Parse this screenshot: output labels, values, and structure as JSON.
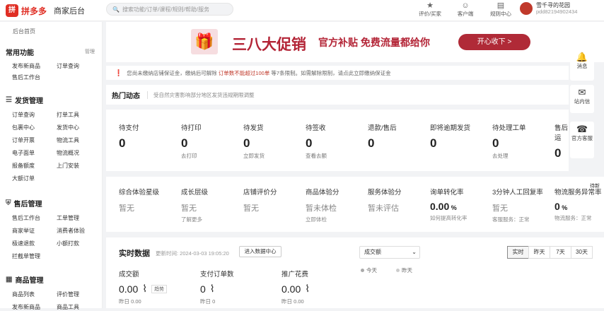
{
  "header": {
    "logo_mark": "拼",
    "logo_text": "拼多多",
    "logo_sub": "商家后台",
    "search_placeholder": "搜索功能/订单/课程/规则/帮助/服务",
    "icons": [
      {
        "name": "rate-icon",
        "glyph": "★",
        "label": "评价/买家"
      },
      {
        "name": "customer-icon",
        "glyph": "☺",
        "label": "客户端"
      },
      {
        "name": "rules-icon",
        "glyph": "▤",
        "label": "规则中心"
      }
    ],
    "shop_name": "雪千寻的花园",
    "shop_id": "pdd82194902434"
  },
  "sidebar": {
    "home": "后台首页",
    "common_title": "常用功能",
    "manage": "管理",
    "common": [
      "发布新商品",
      "订单查询",
      "售后工作台"
    ],
    "ship_title": "发货管理",
    "ship": [
      "订单查询",
      "打单工具",
      "包裹中心",
      "发货中心",
      "订单开票",
      "物流工具",
      "电子面单",
      "物流概况",
      "报备额度",
      "上门安装",
      "大额订单"
    ],
    "after_title": "售后管理",
    "after": [
      "售后工作台",
      "工单管理",
      "商家举证",
      "消费者体验",
      "极速退款",
      "小额打款",
      "拦截单管理"
    ],
    "goods_title": "商品管理",
    "goods": [
      "商品列表",
      "评价管理",
      "发布新商品",
      "商品工具"
    ]
  },
  "banner": {
    "title": "三八大促销",
    "sub": "官方补贴 免费流量都给你",
    "button": "开心收下 >"
  },
  "notice": {
    "text": "您尚未缴纳店铺保证金，缴纳后可解除 ",
    "highlight": "订单数不能超过100单",
    "rest": " 等7条限制。如需解除限制，请点此立即缴纳保证金"
  },
  "hot": {
    "title": "热门动态",
    "desc": "受自然灾害影响部分地区发货违规期限调整"
  },
  "orders": [
    {
      "label": "待支付",
      "value": "0",
      "sub": ""
    },
    {
      "label": "待打印",
      "value": "0",
      "sub": "去打印"
    },
    {
      "label": "待发货",
      "value": "0",
      "sub": "立即发货"
    },
    {
      "label": "待签收",
      "value": "0",
      "sub": "查看去额"
    },
    {
      "label": "退款/售后",
      "value": "0",
      "sub": ""
    },
    {
      "label": "即将逾期发货",
      "value": "0",
      "sub": ""
    },
    {
      "label": "待处理工单",
      "value": "0",
      "sub": "去处理"
    },
    {
      "label": "售后运",
      "value": "0",
      "sub": ""
    }
  ],
  "metrics": [
    {
      "label": "综合体验星级",
      "value": "暂无",
      "sub": ""
    },
    {
      "label": "成长层级",
      "value": "暂无",
      "sub": "了解更多"
    },
    {
      "label": "店铺评价分",
      "value": "暂无",
      "sub": ""
    },
    {
      "label": "商品体验分",
      "value": "暂未体检",
      "sub": "立即体检"
    },
    {
      "label": "服务体验分",
      "value": "暂未评估",
      "sub": ""
    },
    {
      "label": "询单转化率",
      "value": "0.00",
      "unit": "%",
      "sub": "如何提高转化率"
    },
    {
      "label": "3分钟人工回复率",
      "value": "暂无",
      "sub": "客服服务：正常"
    },
    {
      "label": "物流服务异常率",
      "value": "0",
      "unit": "%",
      "sub": "物流服务：正常"
    }
  ],
  "realtime": {
    "title": "实时数据",
    "time": "更新时间: 2024-03-03 19:05:20",
    "enter": "进入数据中心",
    "select": "成交额",
    "ranges": [
      "实时",
      "昨天",
      "7天",
      "30天"
    ],
    "today": "今天",
    "yesterday": "昨天",
    "stats": [
      {
        "label": "成交额",
        "value": "0.00",
        "tag": "趋势",
        "sub": "昨日 0.00"
      },
      {
        "label": "支付订单数",
        "value": "0",
        "tag": "",
        "sub": "昨日 0"
      },
      {
        "label": "推广花费",
        "value": "0.00",
        "tag": "",
        "sub": "昨日 0.00"
      }
    ]
  },
  "float": [
    {
      "name": "message-icon",
      "glyph": "🔔",
      "label": "消息"
    },
    {
      "name": "mail-icon",
      "glyph": "✉",
      "label": "站内信"
    },
    {
      "name": "service-icon",
      "glyph": "☎",
      "label": "官方客服"
    }
  ],
  "corner": "待新"
}
